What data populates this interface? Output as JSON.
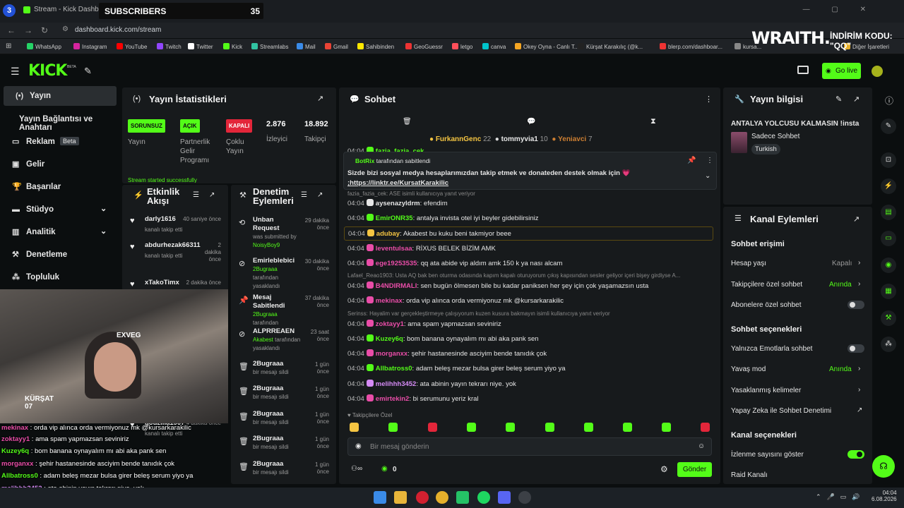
{
  "browser": {
    "tab_counter": "3",
    "tab_title": "Stream - Kick Dashboard",
    "subscribers_label": "SUBSCRIBERS",
    "subscribers_count": "35",
    "url": "dashboard.kick.com/stream"
  },
  "bookmarks": [
    "WhatsApp",
    "Instagram",
    "YouTube",
    "Twitch",
    "Twitter",
    "Kick",
    "Streamlabs",
    "Mail",
    "Gmail",
    "Sahibinden",
    "GeoGuessr",
    "letgo",
    "canva",
    "Okey Oyna - Canlı T...",
    "Kürşat Karakılıç (@k...",
    "blerp.com/dashboar...",
    "kursa...",
    "Diğer İşaretleri"
  ],
  "promo": {
    "brand": "WRAITH.",
    "line1": "İNDİRİM KODU:",
    "line2": "\"QQ\""
  },
  "header": {
    "logo": "KICK",
    "beta": "BETA",
    "go_live": "Go live"
  },
  "sidebar": [
    {
      "label": "Yayın",
      "icon": "broadcast-icon"
    },
    {
      "label": "Yayın Bağlantısı ve Anahtarı",
      "icon": ""
    },
    {
      "label": "Reklam",
      "icon": "tv-icon",
      "badge": "Beta"
    },
    {
      "label": "Gelir",
      "icon": "wallet-icon"
    },
    {
      "label": "Başarılar",
      "icon": "trophy-icon"
    },
    {
      "label": "Stüdyo",
      "icon": "studio-icon"
    },
    {
      "label": "Analitik",
      "icon": "chart-icon"
    },
    {
      "label": "Denetleme",
      "icon": "hammer-icon"
    },
    {
      "label": "Topluluk",
      "icon": "community-icon"
    }
  ],
  "stats": {
    "title": "Yayın İstatistikleri",
    "badges": [
      {
        "badge": "SORUNSUZ",
        "label": "Yayın"
      },
      {
        "badge": "AÇIK",
        "label": "Partnerlik Gelir Programı"
      },
      {
        "badge": "KAPALI",
        "label": "Çoklu Yayın"
      }
    ],
    "viewers": "2.876",
    "viewers_label": "İzleyici",
    "followers": "18.892",
    "followers_label": "Takipçi",
    "status": "Stream started successfully"
  },
  "activity": {
    "title": "Etkinlik Akışı",
    "items": [
      {
        "user": "darly1616",
        "text": "kanalı takip etti",
        "time": "40 saniye önce"
      },
      {
        "user": "abdurhezak66311",
        "text": "kanalı takip etti",
        "time": "2 dakika önce"
      },
      {
        "user": "xTakoTimx",
        "text": "kanalı takip etti",
        "time": "2 dakika önce"
      },
      {
        "user": "godzilla1907",
        "text": "kanalı takip etti",
        "time": "4 dakika önce"
      }
    ]
  },
  "moderation": {
    "title": "Denetim Eylemleri",
    "items": [
      {
        "action": "Unban Request",
        "sub": "was submitted by",
        "by": "NoisyBoy9",
        "time": "29 dakika önce"
      },
      {
        "action": "Emirleblebici",
        "sub": "tarafından yasaklandı",
        "by": "2Bugraaa",
        "time": "30 dakika önce"
      },
      {
        "action": "Mesaj Sabitlendi",
        "sub": "tarafından",
        "by": "2Bugraaa",
        "time": "37 dakika önce"
      },
      {
        "action": "ALPRREAEN",
        "sub": "tarafından yasaklandı",
        "by": "Akabest",
        "time": "23 saat önce"
      },
      {
        "action": "2Bugraaa",
        "sub": "bir mesajı sildi",
        "by": "",
        "time": "1 gün önce"
      },
      {
        "action": "2Bugraaa",
        "sub": "bir mesajı sildi",
        "by": "",
        "time": "1 gün önce"
      },
      {
        "action": "2Bugraaa",
        "sub": "bir mesajı sildi",
        "by": "",
        "time": "1 gün önce"
      },
      {
        "action": "2Bugraaa",
        "sub": "bir mesajı sildi",
        "by": "",
        "time": "1 gün önce"
      },
      {
        "action": "2Bugraaa",
        "sub": "bir mesajı sildi",
        "by": "",
        "time": "1 gün önce"
      }
    ]
  },
  "chat": {
    "title": "Sohbet",
    "top_gifters": [
      {
        "name": "FurkannGenc",
        "count": "22"
      },
      {
        "name": "tommyvia1",
        "count": "10"
      },
      {
        "name": "Yeniavci",
        "count": "7"
      }
    ],
    "pinned": {
      "pinned_by": "BotRix",
      "pinned_suffix": "tarafından sabitlendi",
      "text": "Sizde bizi sosyal medya hesaplarımızdan takip etmek ve donateden destek olmak için 💗",
      "link": ";https://linktr.ee/KursatKarakilic"
    },
    "messages": [
      {
        "time": "04:04",
        "user": "fazia_fazia_cek",
        "text": "",
        "color": "#53fc18",
        "reply": ""
      },
      {
        "time": "",
        "user": "",
        "text": "",
        "color": "",
        "reply": "fazia_fazia_cek: ASE isimli kullanıcıya yanıt veriyor"
      },
      {
        "time": "04:04",
        "user": "aysenazyldrm",
        "text": "efendim",
        "color": "#e6e6e6",
        "reply": ""
      },
      {
        "time": "04:04",
        "user": "EmirONR35",
        "text": "antalya invista otel iyi beyler gidebilirsiniz",
        "color": "#53fc18",
        "reply": ""
      },
      {
        "time": "04:04",
        "user": "adubay",
        "text": "Akabest bu kuku beni takmiyor beee",
        "color": "#f5c542",
        "reply": ""
      },
      {
        "time": "04:04",
        "user": "leventulsaa",
        "text": "RİXUS BELEK BİZİM AMK",
        "color": "#e94da8",
        "reply": ""
      },
      {
        "time": "04:04",
        "user": "ege19253535",
        "text": "qq ata abide vip aldım amk 150 k ya nası alcam",
        "color": "#e94da8",
        "reply": ""
      },
      {
        "time": "",
        "user": "",
        "text": "",
        "color": "",
        "reply": "Lafael_Reao1903: Usta AQ bak ben oturma odasında kapım kapalı oturuyorum çıkış kapısından sesler geliyor içeri bişey girdiyse A..."
      },
      {
        "time": "04:04",
        "user": "B4NDIRMALI",
        "text": "sen bugün ölmesen bile bu kadar paniksen her şey için çok yaşamazsın usta",
        "color": "#e94da8",
        "reply": ""
      },
      {
        "time": "04:04",
        "user": "mekinax",
        "text": "orda vip alınca orda vermiyonuz mk @kursarkarakilic",
        "color": "#e94da8",
        "reply": ""
      },
      {
        "time": "",
        "user": "",
        "text": "",
        "color": "",
        "reply": "Serinss: Hayalim var gerçekleştirmeye çalışıyorum kuzen kusura bakmayın isimli kullanıcıya yanıt veriyor"
      },
      {
        "time": "04:04",
        "user": "zoktayy1",
        "text": "ama spam yapmazsan seviniriz",
        "color": "#e94da8",
        "reply": ""
      },
      {
        "time": "04:04",
        "user": "Kuzey6q",
        "text": "bom banana oynayalım mı abi aka pank sen",
        "color": "#53fc18",
        "reply": ""
      },
      {
        "time": "04:04",
        "user": "morganxx",
        "text": "şehir hastanesinde asciyim bende tanıdık çok",
        "color": "#e94da8",
        "reply": ""
      },
      {
        "time": "04:04",
        "user": "Allbatross0",
        "text": "adam beleş mezar bulsa girer beleş serum yiyo ya",
        "color": "#53fc18",
        "reply": ""
      },
      {
        "time": "04:04",
        "user": "melihhh3452",
        "text": "ata abinin yayın tekrarı niye. yok",
        "color": "#d58bf5",
        "reply": ""
      },
      {
        "time": "04:04",
        "user": "emirtekin2",
        "text": "bi serumunu yeriz kral",
        "color": "#e94da8",
        "reply": ""
      }
    ],
    "followers_only": "Takipçilere Özel",
    "input_placeholder": "Bir mesaj gönderin",
    "points": "0",
    "send": "Gönder"
  },
  "stream_info": {
    "title": "Yayın bilgisi",
    "stream_title": "ANTALYA YOLCUSU KALMASIN !insta",
    "category": "Sadece Sohbet",
    "tag": "Turkish"
  },
  "channel_actions": {
    "title": "Kanal Eylemleri",
    "chat_access": "Sohbet erişimi",
    "account_age": "Hesap yaşı",
    "account_age_val": "Kapalı",
    "followers_only": "Takipçilere özel sohbet",
    "followers_only_val": "Anında",
    "subs_only": "Abonelere özel sohbet",
    "chat_options": "Sohbet seçenekleri",
    "emote_only": "Yalnızca Emotlarla sohbet",
    "slow_mode": "Yavaş mod",
    "slow_mode_val": "Anında",
    "banned_words": "Yasaklanmış kelimeler",
    "ai_moderation": "Yapay Zeka ile Sohbet Denetimi",
    "channel_options": "Kanal seçenekleri",
    "show_viewers": "İzlenme sayısını göster",
    "raid": "Raid Kanalı"
  },
  "overlay_chat": [
    {
      "user": "mekinax",
      "text": "orda vip alınca orda vermiyonuz mk @kursarkarakilic",
      "color": "#e94da8"
    },
    {
      "user": "zoktayy1",
      "text": "ama spam yapmazsan seviniriz",
      "color": "#e94da8"
    },
    {
      "user": "Kuzey6q",
      "text": "bom banana oynayalım mı abi aka pank sen",
      "color": "#53fc18"
    },
    {
      "user": "morganxx",
      "text": "şehir hastanesinde asciyim bende tanıdık çok",
      "color": "#e94da8"
    },
    {
      "user": "Allbatross0",
      "text": "adam beleş mezar bulsa girer beleş serum yiyo ya",
      "color": "#53fc18"
    },
    {
      "user": "melihhh3452",
      "text": "ata abinin yayın tekrarı niye. yok",
      "color": "#d58bf5"
    },
    {
      "user": "emirtekin2",
      "text": "bi serumunu yeriz kral",
      "color": "#e94da8"
    }
  ],
  "cam_text": {
    "brand": "EXVEG",
    "jersey": "KÜRŞAT 07"
  },
  "clock": {
    "time": "04:04",
    "date": "6.08.2026"
  }
}
